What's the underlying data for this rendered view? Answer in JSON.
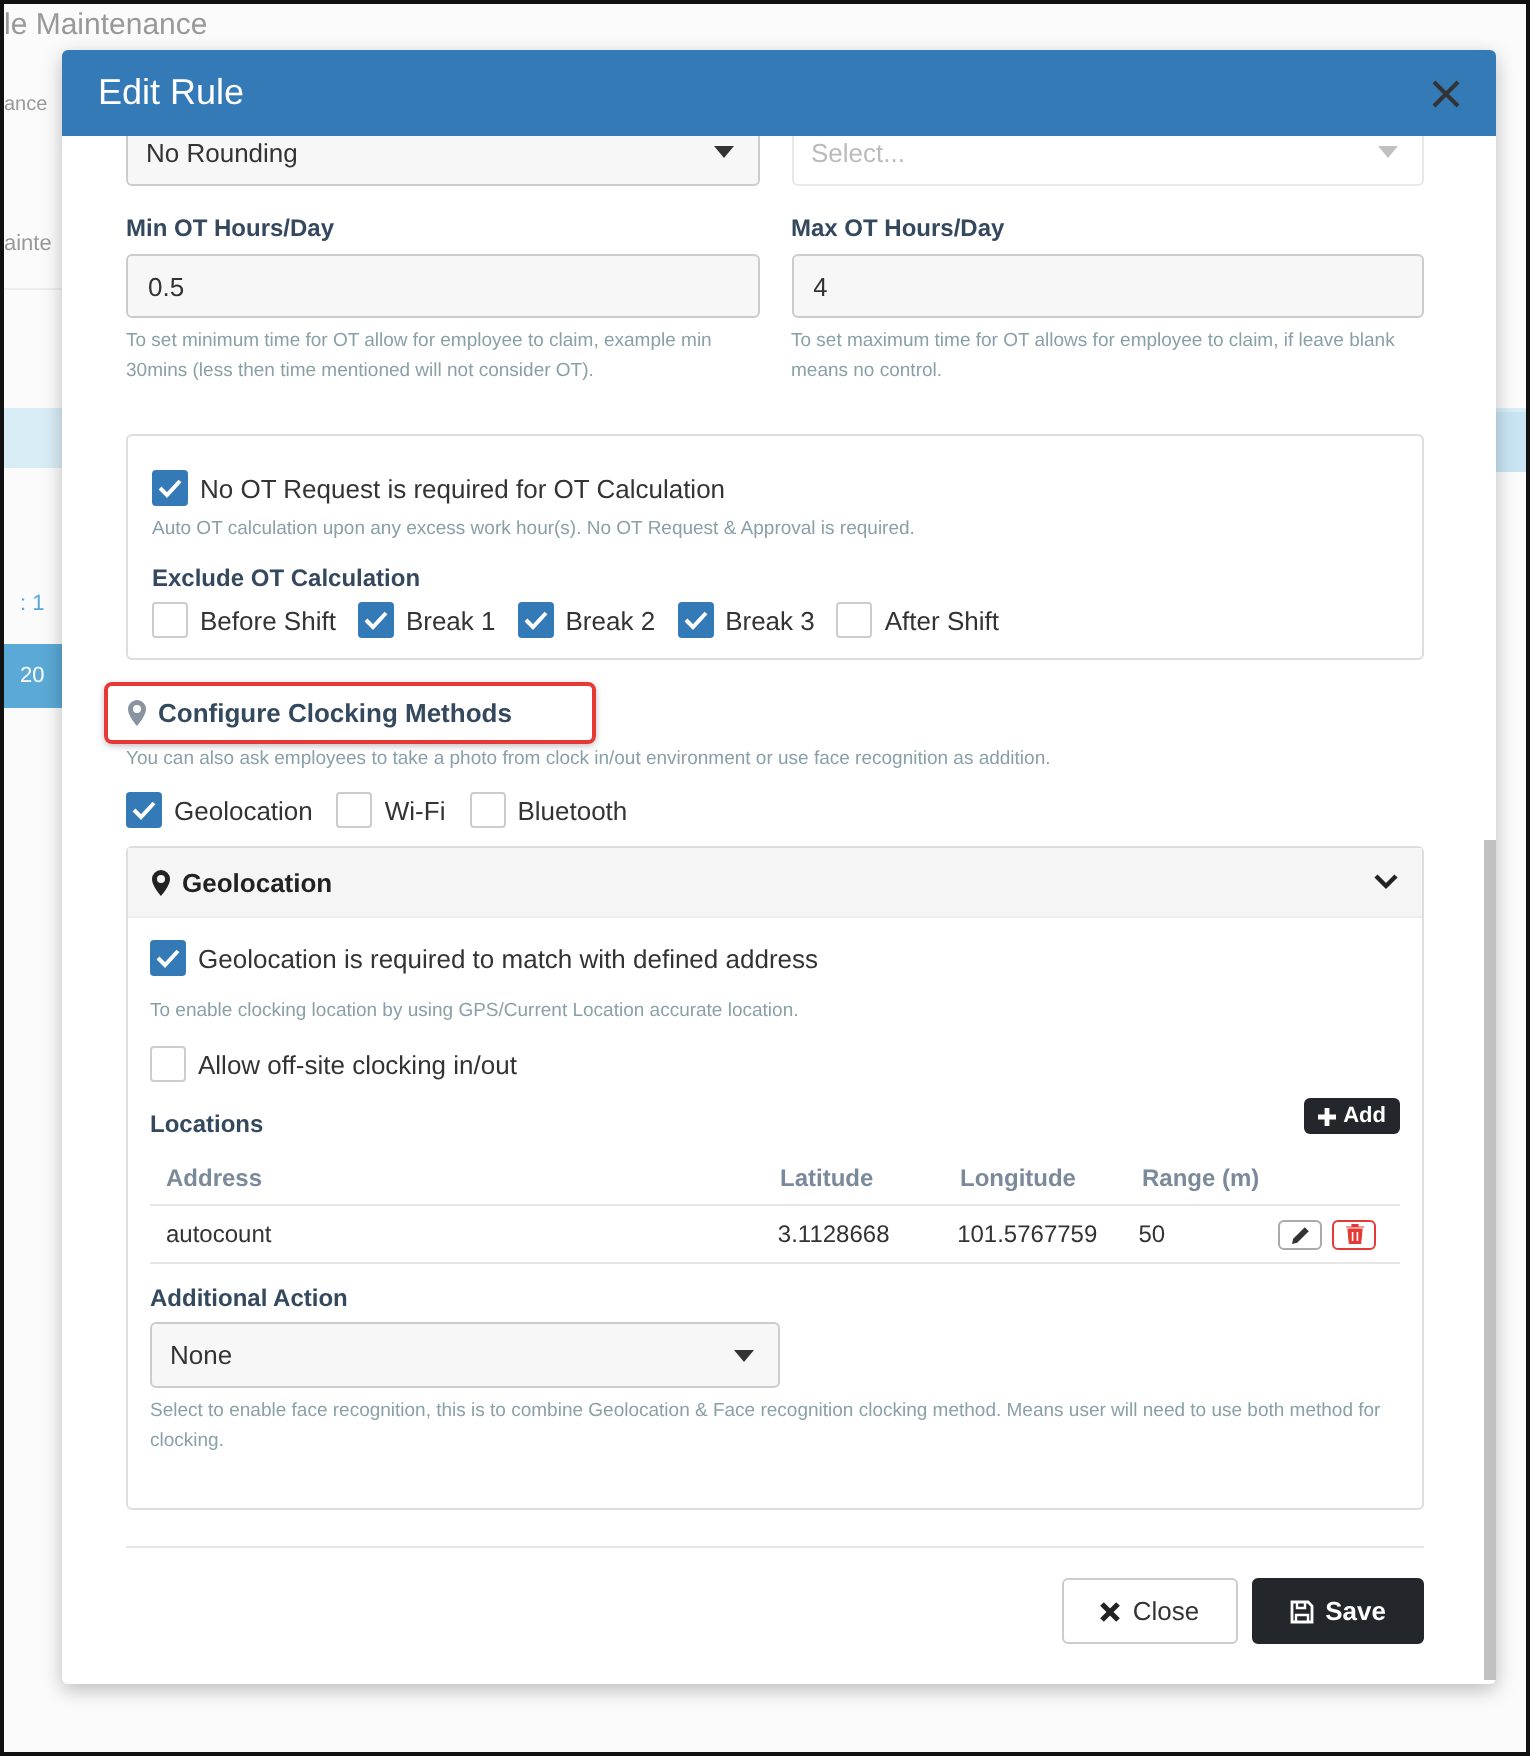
{
  "background": {
    "fragments": [
      {
        "kind": "title",
        "text": "le Maintenance"
      },
      {
        "kind": "subtitle",
        "text": "ance"
      },
      {
        "kind": "tab",
        "text": "ainte"
      },
      {
        "kind": "band"
      },
      {
        "kind": "link",
        "text": ": 1"
      },
      {
        "kind": "selected",
        "text": "20"
      }
    ],
    "right_fragments": [
      {
        "kind": "band"
      }
    ]
  },
  "modal": {
    "title": "Edit Rule",
    "top_selects": [
      {
        "value": "No Rounding",
        "disabled": false
      },
      {
        "placeholder": "Select...",
        "disabled": true
      }
    ],
    "ot_limits": [
      {
        "label": "Min OT Hours/Day",
        "value": "0.5",
        "help": "To set minimum time for OT allow for employee to claim, example min 30mins (less then time mentioned will not consider OT)."
      },
      {
        "label": "Max OT Hours/Day",
        "value": "4",
        "help": "To set maximum time for OT allows for employee to claim, if leave blank means no control."
      }
    ],
    "ot_request": {
      "label": "No OT Request is required for OT Calculation",
      "checked": true,
      "help": "Auto OT calculation upon any excess work hour(s). No OT Request & Approval is required."
    },
    "exclude": {
      "label": "Exclude OT Calculation",
      "options": [
        {
          "label": "Before Shift",
          "checked": false
        },
        {
          "label": "Break 1",
          "checked": true
        },
        {
          "label": "Break 2",
          "checked": true
        },
        {
          "label": "Break 3",
          "checked": true
        },
        {
          "label": "After Shift",
          "checked": false
        }
      ]
    },
    "clocking": {
      "title": "Configure Clocking Methods",
      "highlighted": true,
      "help": "You can also ask employees to take a photo from clock in/out environment or use face recognition as addition.",
      "methods": [
        {
          "label": "Geolocation",
          "checked": true
        },
        {
          "label": "Wi-Fi",
          "checked": false
        },
        {
          "label": "Bluetooth",
          "checked": false
        }
      ]
    },
    "geolocation_panel": {
      "title": "Geolocation",
      "expanded": true,
      "require": {
        "label": "Geolocation is required to match with defined address",
        "checked": true,
        "help": "To enable clocking location by using GPS/Current Location accurate location."
      },
      "offsite": {
        "label": "Allow off-site clocking in/out",
        "checked": false
      },
      "locations": {
        "label": "Locations",
        "add_button": "Add",
        "columns": [
          "Address",
          "Latitude",
          "Longitude",
          "Range (m)"
        ],
        "rows": [
          [
            "autocount",
            "3.1128668",
            "101.5767759",
            "50"
          ]
        ]
      },
      "additional_action": {
        "label": "Additional Action",
        "value": "None",
        "help": "Select to enable face recognition, this is to combine Geolocation & Face recognition clocking method. Means user will need to use both method for clocking."
      }
    },
    "buttons": [
      {
        "kind": "close",
        "label": "Close"
      },
      {
        "kind": "save",
        "label": "Save"
      }
    ]
  }
}
